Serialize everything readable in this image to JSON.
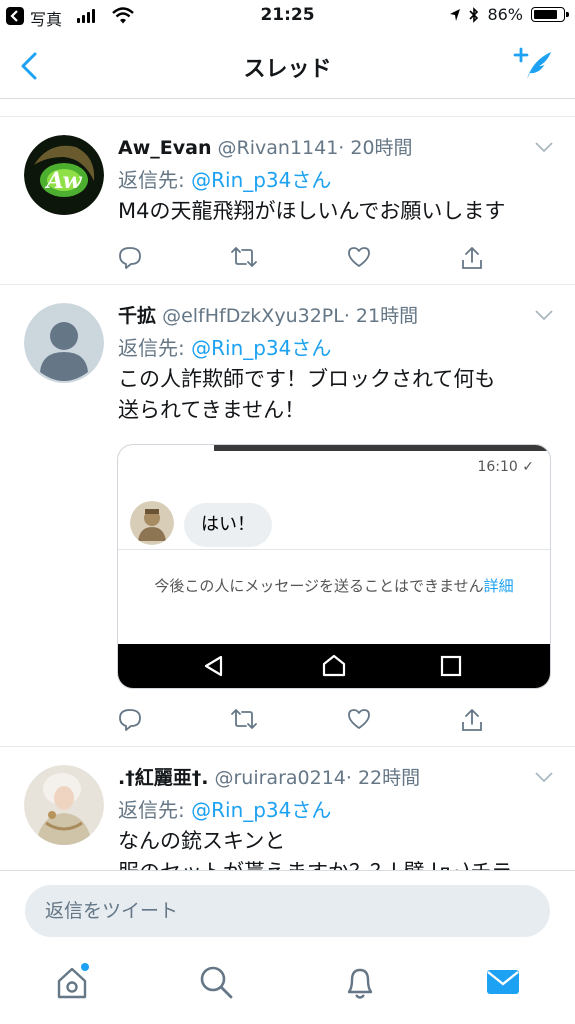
{
  "status": {
    "back_app": "写真",
    "time": "21:25",
    "battery": "86%",
    "battery_level": 0.86
  },
  "nav": {
    "title": "スレッド"
  },
  "tweets": [
    {
      "name": "Aw_Evan",
      "handle": "@Rivan1141",
      "time": "· 20時間",
      "reply_prefix": "返信先: ",
      "reply_to": "@Rin_p34さん",
      "body": "M4の天龍飛翔がほしいんでお願いします",
      "avatar_text": "Aw"
    },
    {
      "name": "千拡",
      "handle": "@elfHfDzkXyu32PL",
      "time": "· 21時間",
      "reply_prefix": "返信先: ",
      "reply_to": "@Rin_p34さん",
      "body": "この人詐欺師です！ブロックされて何も\n送られてきません！",
      "embed": {
        "time": "16:10",
        "check": "✓",
        "bubble": "はい！",
        "notice": "今後この人にメッセージを送ることはできません",
        "notice_link": "詳細"
      }
    },
    {
      "name": ".†紅麗亜†.",
      "handle": "@ruirara0214",
      "time": "· 22時間",
      "reply_prefix": "返信先: ",
      "reply_to": "@Rin_p34さん",
      "body": "なんの銃スキンと\n服のセットが貰えますか？？l 壁 lд･)チラ"
    }
  ],
  "reply": {
    "placeholder": "返信をツイート"
  },
  "colors": {
    "accent": "#1da1f2",
    "secondary": "#657786"
  },
  "icons": {
    "nav": [
      "chevron-left-icon",
      "compose-tweet-icon"
    ],
    "actions": [
      "reply-icon",
      "retweet-icon",
      "like-icon",
      "share-icon"
    ],
    "tabs": [
      "home-icon",
      "search-icon",
      "notifications-icon",
      "messages-icon"
    ]
  }
}
